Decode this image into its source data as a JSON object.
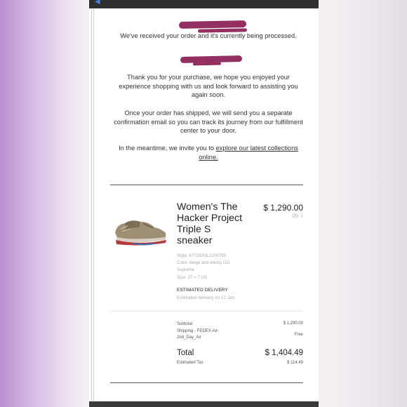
{
  "email": {
    "received": "We've received your order and it's currently being processed.",
    "thanks": "Thank you for your purchase, we hope you enjoyed your experience shopping with us and look forward to assisting you again soon.",
    "shipped": "Once your order has shipped, we will send you a separate confirmation email so you can track its journey from our fulfillment center to your door.",
    "invite_prefix": "In the meantime, we invite you to ",
    "invite_link": "explore our latest collections online."
  },
  "item": {
    "name": "Women's The Hacker Project Triple S sneaker",
    "price": "$ 1,290.00",
    "qty": "Qty: 1",
    "style": "Style: 677192UL2109795",
    "color": "Color: beige and ebony GG Supreme",
    "size": "Size: 37 = 7 US",
    "est_label": "ESTIMATED DELIVERY",
    "est_value": "Estimated delivery on 12 Jan"
  },
  "summary": {
    "subtotal_label": "Subtotal",
    "subtotal_value": "$ 1,290.00",
    "shipping_label": "Shipping - FEDEX-Air-2nd_Day_Air",
    "shipping_value": "Free",
    "total_label": "Total",
    "total_value": "$ 1,404.49",
    "tax_label": "Estimated Tax",
    "tax_value": "$ 114.49"
  },
  "colors": {
    "redaction": "#8e2458",
    "background_accent": "#c9a4d9"
  }
}
